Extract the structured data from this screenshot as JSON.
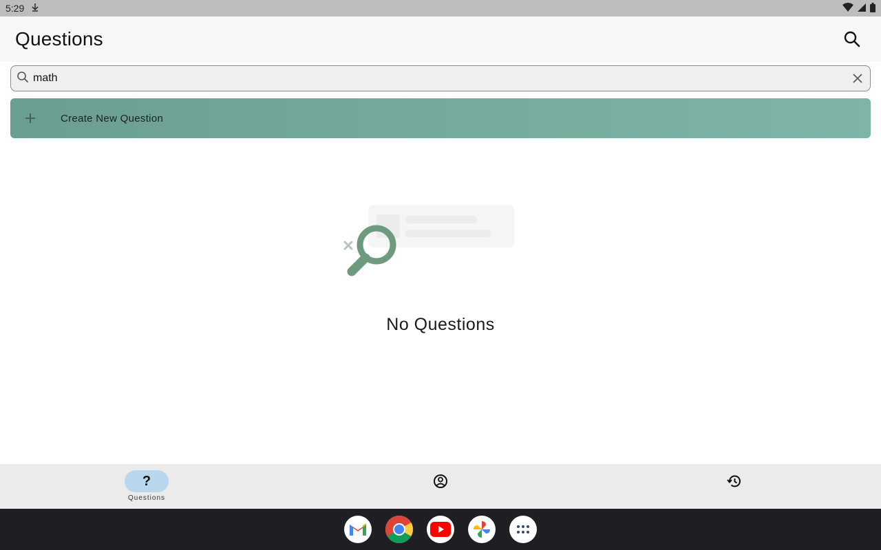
{
  "status_bar": {
    "time": "5:29"
  },
  "app_bar": {
    "title": "Questions"
  },
  "search": {
    "value": "math",
    "placeholder": ""
  },
  "create_button": {
    "label": "Create New Question"
  },
  "empty_state": {
    "text": "No Questions"
  },
  "bottom_nav": {
    "items": [
      {
        "label": "Questions",
        "icon": "question-mark-icon",
        "active": true
      },
      {
        "label": "",
        "icon": "account-circle-icon",
        "active": false
      },
      {
        "label": "",
        "icon": "history-icon",
        "active": false
      }
    ]
  },
  "dock": {
    "apps": [
      "gmail-icon",
      "chrome-icon",
      "youtube-icon",
      "photos-icon",
      "app-drawer-icon"
    ]
  },
  "colors": {
    "create_button_start": "#6a9e90",
    "create_button_end": "#7fb5a8",
    "nav_active_pill": "#b8d6ec",
    "magnifier_green": "#6e9a7f"
  }
}
